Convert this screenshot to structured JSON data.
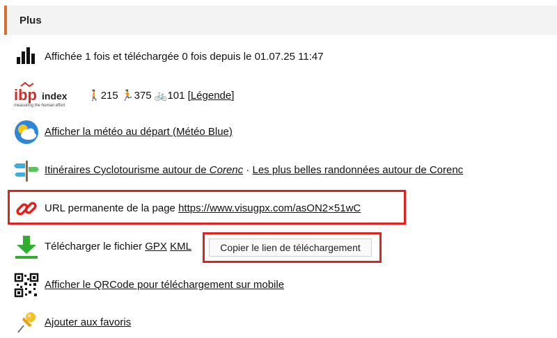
{
  "section": {
    "title": "Plus"
  },
  "stats": {
    "text": "Affichée 1 fois et téléchargée 0 fois depuis le 01.07.25 11:47"
  },
  "ibp": {
    "logo_text": "ibp",
    "logo_sub": "index",
    "logo_tagline": "measuring the human effort",
    "hike": "215",
    "run": "375",
    "bike": "101",
    "legend_link": "Légende"
  },
  "weather": {
    "link": "Afficher la météo au départ (Météo Blue)"
  },
  "itineraries": {
    "link1_prefix": "Itinéraires Cyclotourisme autour de ",
    "link1_place": "Corenc",
    "separator": " · ",
    "link2": "Les plus belles randonnées autour de Corenc"
  },
  "permalink": {
    "label": "URL permanente de la page ",
    "url": "https://www.visugpx.com/asON2×51wC"
  },
  "download": {
    "label": "Télécharger le fichier ",
    "gpx": "GPX",
    "kml": "KML",
    "copy_button": "Copier le lien de téléchargement"
  },
  "qrcode": {
    "link": "Afficher le QRCode pour téléchargement sur mobile"
  },
  "favorites": {
    "link": "Ajouter aux favoris"
  },
  "colors": {
    "accent": "#e06a2b",
    "highlight": "#e3201b",
    "download_green": "#2fae2f"
  }
}
